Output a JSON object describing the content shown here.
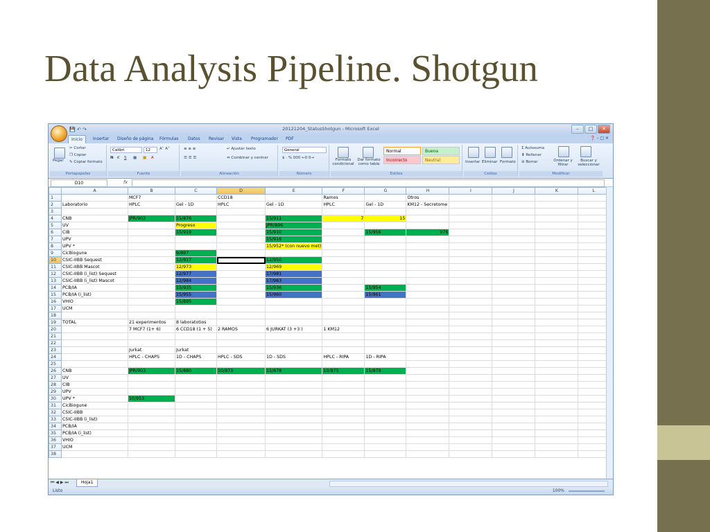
{
  "slide": {
    "title": "Data Analysis Pipeline. Shotgun"
  },
  "window": {
    "title": "20121204_StatusShotgun - Microsoft Excel"
  },
  "ribbon": {
    "tabs": [
      "Inicio",
      "Insertar",
      "Diseño de página",
      "Fórmulas",
      "Datos",
      "Revisar",
      "Vista",
      "Programador",
      "PDF"
    ],
    "clipboard": {
      "paste": "Pegar",
      "cut": "Cortar",
      "copy": "Copiar",
      "format_painter": "Copiar formato",
      "label": "Portapapeles"
    },
    "font": {
      "name": "Calibri",
      "size": "12",
      "label": "Fuente"
    },
    "alignment": {
      "wrap": "Ajustar texto",
      "merge": "Combinar y centrar",
      "label": "Alineación"
    },
    "number": {
      "format": "General",
      "label": "Número"
    },
    "styles": {
      "conditional": "Formato condicional",
      "as_table": "Dar formato como tabla",
      "normal": "Normal",
      "good": "Buena",
      "bad": "Incorrecto",
      "neutral": "Neutral",
      "label": "Estilos"
    },
    "cells": {
      "insert": "Insertar",
      "delete": "Eliminar",
      "format": "Formato",
      "label": "Celdas"
    },
    "editing": {
      "autosum": "Autosuma",
      "fill": "Rellenar",
      "clear": "Borrar",
      "sort": "Ordenar y filtrar",
      "find": "Buscar y seleccionar",
      "label": "Modificar"
    }
  },
  "formula_bar": {
    "name_box": "D10",
    "fx": "fx"
  },
  "sheet": {
    "columns": [
      "A",
      "B",
      "C",
      "D",
      "E",
      "F",
      "G",
      "H",
      "I",
      "J",
      "K",
      "L"
    ],
    "rows": [
      [
        "",
        "MCF7",
        "",
        "CCD18",
        "",
        "Ramos",
        "",
        "Otros",
        "",
        "",
        "",
        ""
      ],
      [
        "Laboratorio",
        "HPLC",
        "Gel - 1D",
        "HPLC",
        "Gel - 1D",
        "HPLC",
        "Gel - 1D",
        "KM12 - Secretome",
        "",
        "",
        "",
        ""
      ],
      [
        "",
        "",
        "",
        "",
        "",
        "",
        "",
        "",
        "",
        "",
        "",
        ""
      ],
      [
        "CNB",
        "JPR/902",
        "15/876",
        "",
        "15/911",
        "7",
        "15",
        "",
        "",
        "",
        "",
        ""
      ],
      [
        "UV",
        "",
        "Progreso",
        "",
        "JPR/896",
        "",
        "",
        "",
        "",
        "",
        "",
        ""
      ],
      [
        "CIB",
        "",
        "15/919",
        "",
        "15/910",
        "",
        "15/956",
        "976",
        "",
        "",
        "",
        ""
      ],
      [
        "UPV",
        "",
        "",
        "",
        "15/916",
        "",
        "",
        "",
        "",
        "",
        "",
        ""
      ],
      [
        "UPV *",
        "",
        "",
        "",
        "15/952* (con nuevo met)",
        "",
        "",
        "",
        "",
        "",
        "",
        ""
      ],
      [
        "CicBiogune",
        "",
        "9/897",
        "",
        "",
        "",
        "",
        "",
        "",
        "",
        "",
        ""
      ],
      [
        "CSIC-IIBB Sequest",
        "",
        "12/917",
        "",
        "12/950",
        "",
        "",
        "",
        "",
        "",
        "",
        ""
      ],
      [
        "CSIC-IIBB Mascot",
        "",
        "12/973",
        "",
        "12/969",
        "",
        "",
        "",
        "",
        "",
        "",
        ""
      ],
      [
        "CSIC-IIBB (i_list) Sequest",
        "",
        "12/977",
        "",
        "17/981",
        "",
        "",
        "",
        "",
        "",
        "",
        ""
      ],
      [
        "CSIC-IIBB (i_list) Mascot",
        "",
        "12/984",
        "",
        "17/983",
        "",
        "",
        "",
        "",
        "",
        "",
        ""
      ],
      [
        "PCB/IA",
        "",
        "15/935",
        "",
        "15/936",
        "",
        "15/954",
        "",
        "",
        "",
        "",
        ""
      ],
      [
        "PCB/IA (i_list)",
        "",
        "15/955",
        "",
        "15/960",
        "",
        "15/961",
        "",
        "",
        "",
        "",
        ""
      ],
      [
        "VHIO",
        "",
        "15/895",
        "",
        "",
        "",
        "",
        "",
        "",
        "",
        "",
        ""
      ],
      [
        "UCM",
        "",
        "",
        "",
        "",
        "",
        "",
        "",
        "",
        "",
        "",
        ""
      ],
      [
        "",
        "",
        "",
        "",
        "",
        "",
        "",
        "",
        "",
        "",
        "",
        ""
      ],
      [
        "TOTAL",
        "21 experimentos",
        "8 laboratotios",
        "",
        "",
        "",
        "",
        "",
        "",
        "",
        "",
        ""
      ],
      [
        "",
        "7 MCF7 (1+ 6)",
        "6 CCD18 (1 + 5)",
        "2 RAMOS",
        "6 JURKAT (3 +3 )",
        "1 KM12",
        "",
        "",
        "",
        "",
        "",
        ""
      ],
      [
        "",
        "",
        "",
        "",
        "",
        "",
        "",
        "",
        "",
        "",
        "",
        ""
      ],
      [
        "",
        "",
        "",
        "",
        "",
        "",
        "",
        "",
        "",
        "",
        "",
        ""
      ],
      [
        "",
        "Jurkat",
        "Jurkat",
        "",
        "",
        "",
        "",
        "",
        "",
        "",
        "",
        ""
      ],
      [
        "",
        "HPLC - CHAPS",
        "1D - CHAPS",
        "HPLC - SDS",
        "1D - SDS",
        "HPLC - RIPA",
        "1D - RIPA",
        "",
        "",
        "",
        "",
        ""
      ],
      [
        "",
        "",
        "",
        "",
        "",
        "",
        "",
        "",
        "",
        "",
        "",
        ""
      ],
      [
        "CNB",
        "JPR/903",
        "15/880",
        "10/873",
        "15/878",
        "10/875",
        "15/879",
        "",
        "",
        "",
        "",
        ""
      ],
      [
        "UV",
        "",
        "",
        "",
        "",
        "",
        "",
        "",
        "",
        "",
        "",
        ""
      ],
      [
        "CIB",
        "",
        "",
        "",
        "",
        "",
        "",
        "",
        "",
        "",
        "",
        ""
      ],
      [
        "UPV",
        "",
        "",
        "",
        "",
        "",
        "",
        "",
        "",
        "",
        "",
        ""
      ],
      [
        "UPV *",
        "10/953",
        "",
        "",
        "",
        "",
        "",
        "",
        "",
        "",
        "",
        ""
      ],
      [
        "CicBiogune",
        "",
        "",
        "",
        "",
        "",
        "",
        "",
        "",
        "",
        "",
        ""
      ],
      [
        "CSIC-IIBB",
        "",
        "",
        "",
        "",
        "",
        "",
        "",
        "",
        "",
        "",
        ""
      ],
      [
        "CSIC-IIBB (i_list)",
        "",
        "",
        "",
        "",
        "",
        "",
        "",
        "",
        "",
        "",
        ""
      ],
      [
        "PCB/IA",
        "",
        "",
        "",
        "",
        "",
        "",
        "",
        "",
        "",
        "",
        ""
      ],
      [
        "PCB/IA (i_list)",
        "",
        "",
        "",
        "",
        "",
        "",
        "",
        "",
        "",
        "",
        ""
      ],
      [
        "VHIO",
        "",
        "",
        "",
        "",
        "",
        "",
        "",
        "",
        "",
        "",
        ""
      ],
      [
        "UCM",
        "",
        "",
        "",
        "",
        "",
        "",
        "",
        "",
        "",
        "",
        ""
      ],
      [
        "",
        "",
        "",
        "",
        "",
        "",
        "",
        "",
        "",
        "",
        "",
        ""
      ]
    ],
    "colors": {
      "green": "#00b050",
      "yellow": "#ffff00",
      "blue": "#4472c4"
    }
  },
  "sheet_tabs": [
    "Hoja1"
  ],
  "status": {
    "ready": "Listo",
    "zoom": "100%"
  }
}
